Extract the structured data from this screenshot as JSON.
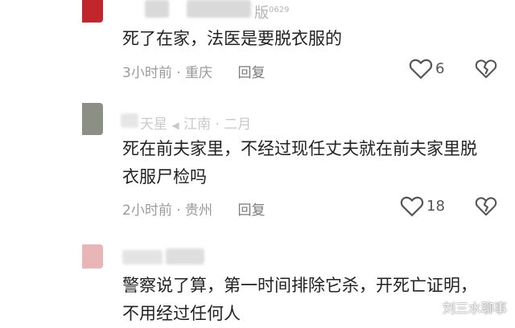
{
  "comments": [
    {
      "username_fragment": "版",
      "username_num": "0629",
      "text": [
        "死了在家，法医是要脱衣服的"
      ],
      "time": "3小时前",
      "location": "重庆",
      "reply_label": "回复",
      "likes": "6"
    },
    {
      "username_fragment": "天星",
      "username_suffix": "江南 · 二月",
      "text": [
        "死在前夫家里，不经过现任丈夫就在前夫家里脱",
        "衣服尸检吗"
      ],
      "time": "2小时前",
      "location": "贵州",
      "reply_label": "回复",
      "likes": "18"
    },
    {
      "text": [
        "警察说了算，第一时间排除它杀，开死亡证明，",
        "不用经过任何人"
      ]
    }
  ],
  "watermark": "刘三水聊事",
  "colors": {
    "avatar1": "#c0262b",
    "avatar2": "#8b8f84",
    "avatar3": "#e8b6b6"
  }
}
